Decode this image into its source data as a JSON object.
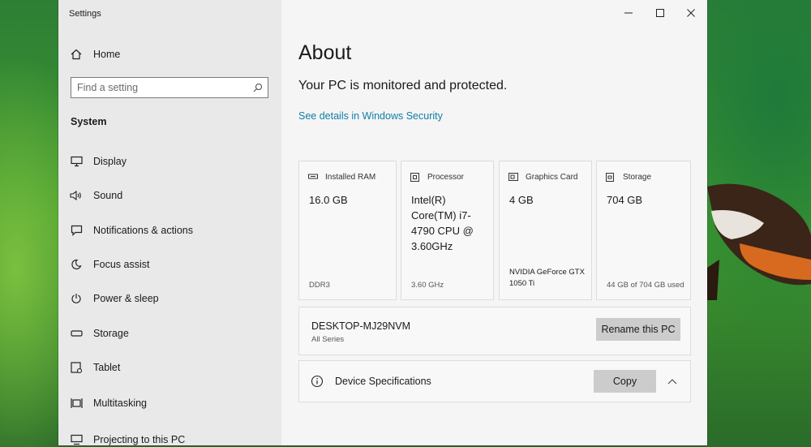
{
  "window": {
    "app_title": "Settings"
  },
  "sidebar": {
    "home": "Home",
    "search": {
      "placeholder": "Find a setting"
    },
    "section": "System",
    "items": [
      {
        "label": "Display",
        "icon": "monitor-icon"
      },
      {
        "label": "Sound",
        "icon": "speaker-icon"
      },
      {
        "label": "Notifications & actions",
        "icon": "notification-icon"
      },
      {
        "label": "Focus assist",
        "icon": "moon-icon"
      },
      {
        "label": "Power & sleep",
        "icon": "power-icon"
      },
      {
        "label": "Storage",
        "icon": "storage-icon"
      },
      {
        "label": "Tablet",
        "icon": "tablet-icon"
      },
      {
        "label": "Multitasking",
        "icon": "multitasking-icon"
      },
      {
        "label": "Projecting to this PC",
        "icon": "projecting-icon"
      }
    ]
  },
  "main": {
    "title": "About",
    "status": "Your PC is monitored and protected.",
    "security_link": "See details in Windows Security",
    "cards": [
      {
        "label": "Installed RAM",
        "value": "16.0 GB",
        "sub": "DDR3",
        "icon": "memory-icon"
      },
      {
        "label": "Processor",
        "value": "Intel(R) Core(TM) i7-4790 CPU @ 3.60GHz",
        "sub": "3.60 GHz",
        "icon": "processor-icon"
      },
      {
        "label": "Graphics Card",
        "value": "4 GB",
        "model": "NVIDIA GeForce GTX 1050 Ti",
        "icon": "graphics-card-icon"
      },
      {
        "label": "Storage",
        "value": "704 GB",
        "sub": "44 GB of 704 GB used",
        "icon": "storage-drive-icon"
      }
    ],
    "pc": {
      "name": "DESKTOP-MJ29NVM",
      "model": "All Series",
      "rename_label": "Rename this PC"
    },
    "specs": {
      "label": "Device Specifications",
      "copy_label": "Copy"
    }
  }
}
